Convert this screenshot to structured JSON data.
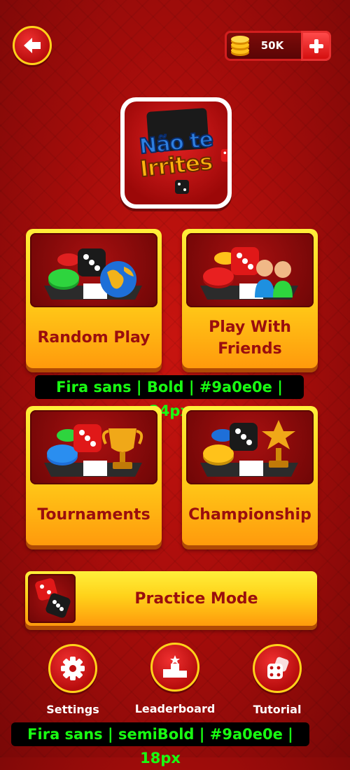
{
  "header": {
    "back_icon": "arrow-left-icon",
    "coins": "50K",
    "coin_icon": "coin-stack-icon",
    "add_icon": "plus-icon"
  },
  "logo": {
    "line1": "Não te",
    "line2": "Irrites"
  },
  "modes": [
    {
      "label": "Random Play",
      "icon": "globe-icon"
    },
    {
      "label": "Play With Friends",
      "label_line1": "Play With",
      "label_line2": "Friends",
      "icon": "friends-icon"
    },
    {
      "label": "Tournaments",
      "icon": "trophy-icon"
    },
    {
      "label": "Championship",
      "icon": "star-trophy-icon"
    }
  ],
  "spec_notes": {
    "title_font": "Fira sans | Bold | #9a0e0e | 24px",
    "nav_font": "Fira sans | semiBold | #9a0e0e | 18px"
  },
  "practice": {
    "label": "Practice Mode",
    "icon": "dice-icon"
  },
  "nav": [
    {
      "label": "Settings",
      "icon": "gear-icon"
    },
    {
      "label": "Leaderboard",
      "icon": "podium-icon"
    },
    {
      "label": "Tutorial",
      "icon": "dice-icon"
    }
  ],
  "colors": {
    "background": "#b70d0d",
    "accent_yellow": "#ffd21a",
    "label_text": "#9a0e0e",
    "spec_text": "#19ff12"
  }
}
